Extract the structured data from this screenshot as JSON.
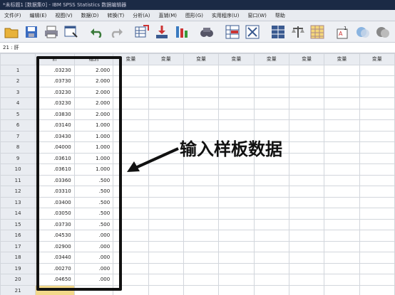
{
  "window": {
    "title": "*未标题1 [数据集0] - IBM SPSS Statistics 数据编辑器"
  },
  "menu": [
    "文件(F)",
    "编辑(E)",
    "视图(V)",
    "数据(D)",
    "转换(T)",
    "分析(A)",
    "直销(M)",
    "图形(G)",
    "实用程序(U)",
    "窗口(W)",
    "帮助"
  ],
  "toolbar": {
    "icons": [
      "open-icon",
      "save-icon",
      "print-icon",
      "dialog-recall-icon",
      "undo-icon",
      "redo-icon",
      "goto-case-icon",
      "goto-variable-icon",
      "variables-icon",
      "find-icon",
      "insert-cases-icon",
      "insert-variable-icon",
      "split-file-icon",
      "weight-cases-icon",
      "select-cases-icon",
      "value-labels-icon",
      "use-sets-icon",
      "show-all-icon"
    ]
  },
  "cell_editor": {
    "ref": "21 : 肝"
  },
  "grid": {
    "columns": [
      "肝",
      "组别",
      "变量",
      "变量",
      "变量",
      "变量",
      "变量",
      "变量",
      "变量",
      "变量"
    ],
    "rows": [
      {
        "n": "1",
        "a": ".03230",
        "b": "2.000"
      },
      {
        "n": "2",
        "a": ".03730",
        "b": "2.000"
      },
      {
        "n": "3",
        "a": ".03230",
        "b": "2.000"
      },
      {
        "n": "4",
        "a": ".03230",
        "b": "2.000"
      },
      {
        "n": "5",
        "a": ".03830",
        "b": "2.000"
      },
      {
        "n": "6",
        "a": ".03140",
        "b": "1.000"
      },
      {
        "n": "7",
        "a": ".03430",
        "b": "1.000"
      },
      {
        "n": "8",
        "a": ".04000",
        "b": "1.000"
      },
      {
        "n": "9",
        "a": ".03610",
        "b": "1.000"
      },
      {
        "n": "10",
        "a": ".03610",
        "b": "1.000"
      },
      {
        "n": "11",
        "a": ".03360",
        "b": ".500"
      },
      {
        "n": "12",
        "a": ".03310",
        "b": ".500"
      },
      {
        "n": "13",
        "a": ".03400",
        "b": ".500"
      },
      {
        "n": "14",
        "a": ".03050",
        "b": ".500"
      },
      {
        "n": "15",
        "a": ".03730",
        "b": ".500"
      },
      {
        "n": "16",
        "a": ".04530",
        "b": ".000"
      },
      {
        "n": "17",
        "a": ".02900",
        "b": ".000"
      },
      {
        "n": "18",
        "a": ".03440",
        "b": ".000"
      },
      {
        "n": "19",
        "a": ".00270",
        "b": ".000"
      },
      {
        "n": "20",
        "a": ".04650",
        "b": ".000"
      },
      {
        "n": "21",
        "a": "",
        "b": ""
      }
    ]
  },
  "annotation": {
    "text": "输入样板数据"
  }
}
